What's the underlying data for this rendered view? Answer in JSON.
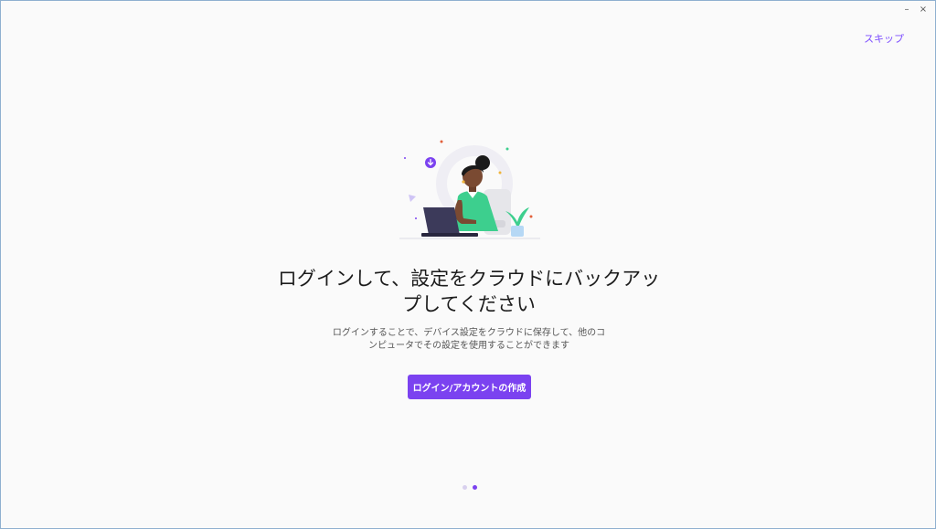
{
  "window": {
    "minimize_glyph": "–",
    "close_glyph": "×"
  },
  "header": {
    "skip_label": "スキップ"
  },
  "illustration": {
    "name": "person-at-laptop-illustration",
    "accent_color": "#7b42f0",
    "shirt_color": "#3dcf8e"
  },
  "main": {
    "title": "ログインして、設定をクラウドにバックアップしてください",
    "description": "ログインすることで、デバイス設定をクラウドに保存して、他のコンピュータでその設定を使用することができます",
    "login_button_label": "ログイン/アカウントの作成"
  },
  "pager": {
    "page_count": 2,
    "current_page": 2
  },
  "colors": {
    "accent": "#7b42f0",
    "background": "#fafafa"
  }
}
